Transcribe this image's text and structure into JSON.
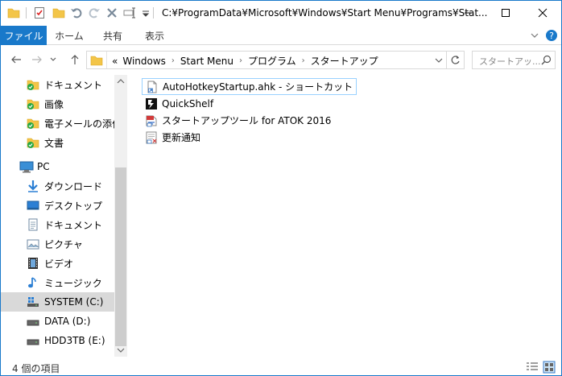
{
  "window": {
    "title": "C:¥ProgramData¥Microsoft¥Windows¥Start Menu¥Programs¥Stat...",
    "minimize_label": "—",
    "maximize_label": "☐",
    "close_label": "✕"
  },
  "ribbon": {
    "tabs": [
      "ファイル",
      "ホーム",
      "共有",
      "表示"
    ],
    "collapse_glyph": "⌄",
    "help_glyph": "?"
  },
  "address": {
    "overflow_glyph": "«",
    "crumbs": [
      "Windows",
      "Start Menu",
      "プログラム",
      "スタートアップ"
    ]
  },
  "search": {
    "placeholder": "スタートアッ..."
  },
  "nav": {
    "items": [
      {
        "label": "ドキュメント",
        "icon": "folder-pinned-icon"
      },
      {
        "label": "画像",
        "icon": "folder-pinned-icon"
      },
      {
        "label": "電子メールの添付",
        "icon": "folder-pinned-icon"
      },
      {
        "label": "文書",
        "icon": "folder-pinned-icon"
      },
      {
        "label": "PC",
        "icon": "pc-icon"
      },
      {
        "label": "ダウンロード",
        "icon": "download-icon"
      },
      {
        "label": "デスクトップ",
        "icon": "desktop-icon"
      },
      {
        "label": "ドキュメント",
        "icon": "document-icon"
      },
      {
        "label": "ピクチャ",
        "icon": "pictures-icon"
      },
      {
        "label": "ビデオ",
        "icon": "video-icon"
      },
      {
        "label": "ミュージック",
        "icon": "music-icon"
      },
      {
        "label": "SYSTEM (C:)",
        "icon": "system-drive-icon"
      },
      {
        "label": "DATA (D:)",
        "icon": "drive-icon"
      },
      {
        "label": "HDD3TB (E:)",
        "icon": "drive-icon"
      }
    ]
  },
  "files": [
    {
      "label": "AutoHotkeyStartup.ahk - ショートカット",
      "icon": "ahk-shortcut-icon"
    },
    {
      "label": "QuickShelf",
      "icon": "quickshelf-icon"
    },
    {
      "label": "スタートアップツール for ATOK 2016",
      "icon": "atok-icon"
    },
    {
      "label": "更新通知",
      "icon": "update-notify-icon"
    }
  ],
  "status": {
    "item_count": "4 個の項目"
  },
  "colors": {
    "accent": "#1979ca",
    "selection": "#d9d9d9",
    "folder": "#f3c548",
    "pin": "#27a844"
  }
}
